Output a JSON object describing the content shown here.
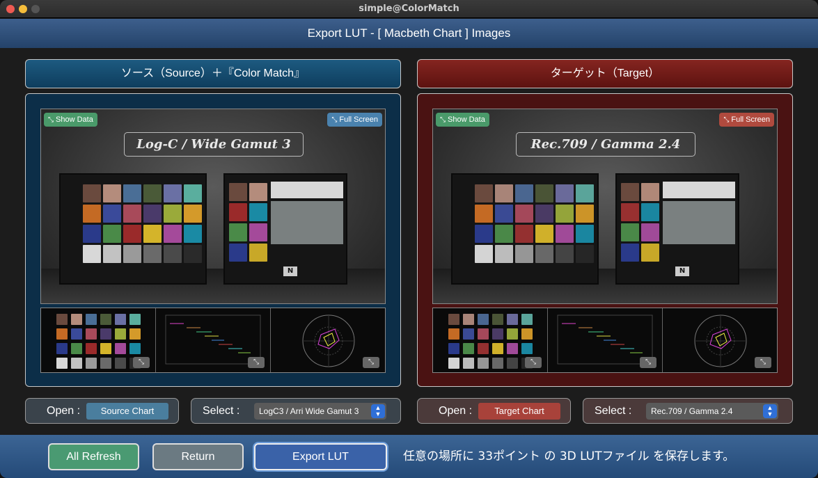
{
  "window": {
    "title": "simple@ColorMatch"
  },
  "header": {
    "title": "Export LUT - [ Macbeth Chart ] Images"
  },
  "source": {
    "panel_title": "ソース（Source）＋『Color Match』",
    "show_data_label": "Show Data",
    "full_screen_label": "Full Screen",
    "image_label": "Log-C / Wide Gamut 3",
    "open_caption": "Open :",
    "open_button": "Source Chart",
    "select_caption": "Select :",
    "select_value": "LogC3 / Arri Wide Gamut 3",
    "chart_n": "N",
    "patches": [
      "#6a4a3e",
      "#b48c7c",
      "#4a6e96",
      "#4a5a38",
      "#6a70a4",
      "#5aae9e",
      "#c46a24",
      "#3a4a9a",
      "#a84a5a",
      "#4a3a6a",
      "#9aaa3a",
      "#d49a2a",
      "#2a3a8a",
      "#4a8a48",
      "#9a2a2a",
      "#d4b42a",
      "#a44a9a",
      "#1a8aa4",
      "#d8d8d8",
      "#c2c2c2",
      "#9a9a9a",
      "#6a6a6a",
      "#4a4a4a",
      "#2a2a2a"
    ],
    "side_patches": [
      "#6a4a3e",
      "#b48c7c",
      "#9a2a2a",
      "#1a8aa4",
      "#4a8a48",
      "#a44a9a",
      "#2a3a8a",
      "#c8a828"
    ]
  },
  "target": {
    "panel_title": "ターゲット（Target）",
    "show_data_label": "Show Data",
    "full_screen_label": "Full Screen",
    "image_label": "Rec.709 / Gamma 2.4",
    "open_caption": "Open :",
    "open_button": "Target Chart",
    "select_caption": "Select :",
    "select_value": "Rec.709 / Gamma 2.4",
    "chart_n": "N",
    "patches": [
      "#6a4a3e",
      "#a88478",
      "#4a6690",
      "#4a5436",
      "#6a6a9a",
      "#5aa49a",
      "#c46a24",
      "#3a4a94",
      "#a4485a",
      "#4a3a64",
      "#94a43a",
      "#cc9428",
      "#2a3a8a",
      "#4a8848",
      "#943030",
      "#d0b02a",
      "#a04a98",
      "#1a86a0",
      "#d4d4d4",
      "#bcbcbc",
      "#969696",
      "#686868",
      "#444444",
      "#262626"
    ],
    "side_patches": [
      "#6a4a3e",
      "#b08878",
      "#983030",
      "#1a86a0",
      "#4a8848",
      "#a04a98",
      "#2a3a8a",
      "#c8a828"
    ]
  },
  "footer": {
    "all_refresh": "All Refresh",
    "return": "Return",
    "export_lut": "Export LUT",
    "note": "任意の場所に 33ポイント の 3D LUTファイル を保存します。"
  }
}
